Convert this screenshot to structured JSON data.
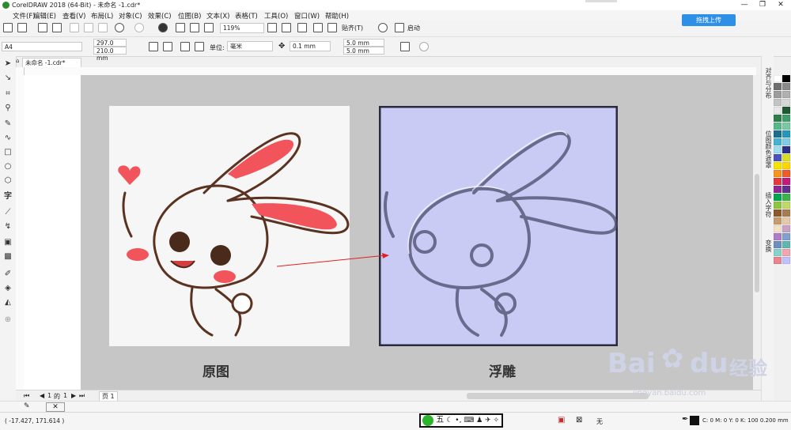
{
  "window": {
    "title": "CorelDRAW 2018 (64-Bit) - 未命名 -1.cdr*",
    "minimize": "—",
    "restore": "❐",
    "close": "✕"
  },
  "menu": [
    "文件(F)",
    "编辑(E)",
    "查看(V)",
    "布局(L)",
    "对象(C)",
    "效果(C)",
    "位图(B)",
    "文本(X)",
    "表格(T)",
    "工具(O)",
    "窗口(W)",
    "帮助(H)"
  ],
  "toolbar": {
    "zoom": "119%",
    "snap_label": "贴齐(T)",
    "launch_label": "启动",
    "upload_button": "拖拽上传"
  },
  "property_bar": {
    "page_size": "A4",
    "width": "297.0 mm",
    "height": "210.0 mm",
    "units_label": "单位:",
    "units": "毫米",
    "nudge": "0.1 mm",
    "dup_x": "5.0 mm",
    "dup_y": "5.0 mm"
  },
  "document_tab": "未命名 -1.cdr*",
  "canvas": {
    "caption_left": "原图",
    "caption_right": "浮雕"
  },
  "dockers": [
    "对齐与分布",
    "位图颜色遮罩",
    "插入字符",
    "变换"
  ],
  "page_nav": {
    "current": "1",
    "of_label": "的",
    "total": "1",
    "page_tab": "页 1"
  },
  "status": {
    "coordinates": "( -17.427, 171.614 )",
    "ime_label": "五",
    "fill_label": "无",
    "color_info": "C: 0 M: 0 Y: 0 K: 100  0.200 mm"
  },
  "watermark": {
    "brand": "Bai",
    "brand2": "du",
    "cn": "经验",
    "url": "jingyan.baidu.com"
  },
  "palette_colors": [
    "#ffffff",
    "#000000",
    "#6f6f6f",
    "#8a8a8a",
    "#9c9c9c",
    "#b0b0b0",
    "#c4c4c4",
    "#d8d8d8",
    "#e8e8e8",
    "#1e5a32",
    "#2e7d4b",
    "#3f9e6a",
    "#59b88a",
    "#7ac9a4",
    "#1c6f8c",
    "#2596be",
    "#48b2d4",
    "#7ccde6",
    "#9edcf0",
    "#2b2f8f",
    "#4c53b8",
    "#d7df23",
    "#f5e400",
    "#ffd700",
    "#f7941d",
    "#f15a29",
    "#e23b3b",
    "#c5197d",
    "#92278f",
    "#662d91",
    "#00a651",
    "#39b54a",
    "#8dc63f",
    "#c2d96a",
    "#8b5a2b",
    "#a67c52",
    "#c69c6d",
    "#e6c9a8",
    "#f5e0c8",
    "#c8a2c8",
    "#b07cc6",
    "#7ea1d1",
    "#6f8fbf",
    "#5fb8b0",
    "#88d3c9",
    "#f2a7b0",
    "#e8848f",
    "#c0c0ff"
  ]
}
